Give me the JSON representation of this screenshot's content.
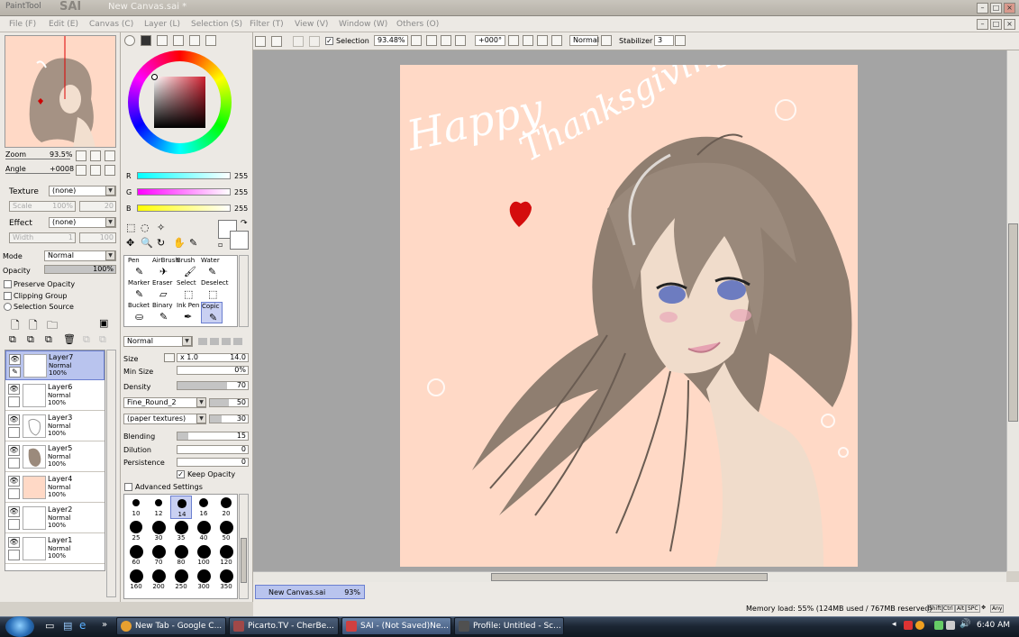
{
  "window": {
    "app_logo": "PaintTool",
    "app_name": "SAI",
    "title": "New Canvas.sai *"
  },
  "menu": [
    "File (F)",
    "Edit (E)",
    "Canvas (C)",
    "Layer (L)",
    "Selection (S)",
    "Filter (T)",
    "View (V)",
    "Window (W)",
    "Others (O)"
  ],
  "navigator": {
    "zoom_label": "Zoom",
    "zoom_value": "93.5%",
    "angle_label": "Angle",
    "angle_value": "+0008"
  },
  "texture": {
    "label": "Texture",
    "value": "(none)",
    "scale_label": "Scale",
    "scale_value": "100%",
    "scale_num": "20"
  },
  "effect": {
    "label": "Effect",
    "value": "(none)",
    "width_label": "Width",
    "width_value": "1",
    "width_num": "100"
  },
  "layer_props": {
    "mode_label": "Mode",
    "mode_value": "Normal",
    "opacity_label": "Opacity",
    "opacity_value": "100%",
    "opacity": 1.0,
    "preserve_opacity": "Preserve Opacity",
    "clipping_group": "Clipping Group",
    "selection_source": "Selection Source"
  },
  "layers": [
    {
      "name": "Layer7",
      "mode": "Normal",
      "opacity": "100%",
      "selected": true
    },
    {
      "name": "Layer6",
      "mode": "Normal",
      "opacity": "100%",
      "selected": false
    },
    {
      "name": "Layer3",
      "mode": "Normal",
      "opacity": "100%",
      "selected": false
    },
    {
      "name": "Layer5",
      "mode": "Normal",
      "opacity": "100%",
      "selected": false
    },
    {
      "name": "Layer4",
      "mode": "Normal",
      "opacity": "100%",
      "selected": false
    },
    {
      "name": "Layer2",
      "mode": "Normal",
      "opacity": "100%",
      "selected": false
    },
    {
      "name": "Layer1",
      "mode": "Normal",
      "opacity": "100%",
      "selected": false
    }
  ],
  "color": {
    "r_label": "R",
    "g_label": "G",
    "b_label": "B",
    "r": "255",
    "g": "255",
    "b": "255",
    "swatch": "#ffffff"
  },
  "tools": [
    {
      "name": "Pen",
      "icon": "pen-icon",
      "glyph": "✎"
    },
    {
      "name": "AirBrush",
      "icon": "airbrush-icon",
      "glyph": "✈"
    },
    {
      "name": "Brush",
      "icon": "brush-icon",
      "glyph": "🖌"
    },
    {
      "name": "Water",
      "icon": "water-icon",
      "glyph": "✎"
    },
    {
      "name": "Marker",
      "icon": "marker-icon",
      "glyph": "✎"
    },
    {
      "name": "Eraser",
      "icon": "eraser-icon",
      "glyph": "▱"
    },
    {
      "name": "Select",
      "icon": "select-icon",
      "glyph": "⬚"
    },
    {
      "name": "Deselect",
      "icon": "deselect-icon",
      "glyph": "⬚"
    },
    {
      "name": "Bucket",
      "icon": "bucket-icon",
      "glyph": "⛀"
    },
    {
      "name": "Binary",
      "icon": "binary-icon",
      "glyph": "✎"
    },
    {
      "name": "Ink Pen",
      "icon": "ink-pen-icon",
      "glyph": "✒"
    },
    {
      "name": "Copic",
      "icon": "copic-icon",
      "glyph": "✎"
    }
  ],
  "brush": {
    "blend_mode": "Normal",
    "size_label": "Size",
    "size_mult": "x 1.0",
    "size_value": "14.0",
    "min_size_label": "Min Size",
    "min_size_value": "0%",
    "density_label": "Density",
    "density_value": "70",
    "shape": "Fine_Round_2",
    "shape_value": "50",
    "texture": "(paper textures)",
    "texture_value": "30",
    "blending_label": "Blending",
    "blending_value": "15",
    "dilution_label": "Dilution",
    "dilution_value": "0",
    "persistence_label": "Persistence",
    "persistence_value": "0",
    "keep_opacity": "Keep Opacity",
    "advanced": "Advanced Settings",
    "presets": [
      "10",
      "12",
      "14",
      "16",
      "20",
      "25",
      "30",
      "35",
      "40",
      "50",
      "60",
      "70",
      "80",
      "100",
      "120",
      "160",
      "200",
      "250",
      "300",
      "350"
    ]
  },
  "canvas_toolbar": {
    "selection_label": "Selection",
    "zoom": "93.48%",
    "angle": "+000°",
    "blend": "Normal",
    "stabilizer_label": "Stabilizer",
    "stabilizer_value": "3"
  },
  "artwork": {
    "greeting_line1": "Happy",
    "greeting_line2": "Thanksgiving.",
    "background": "#ffd9c6"
  },
  "doc_tab": {
    "name": "New Canvas.sai",
    "zoom": "93%"
  },
  "status": {
    "memory": "Memory load: 55% (124MB used / 767MB reserved)",
    "keys": [
      "Shift",
      "Ctrl",
      "Alt",
      "SPC",
      "Any"
    ]
  },
  "taskbar": {
    "items": [
      {
        "label": "New Tab - Google C...",
        "color": "#e8a030"
      },
      {
        "label": "Picarto.TV - CherBe...",
        "color": "#a04848"
      },
      {
        "label": "SAI - (Not Saved)Ne...",
        "color": "#d04040"
      },
      {
        "label": "Profile: Untitled - Sc...",
        "color": "#505050"
      }
    ],
    "clock": "6:40 AM"
  }
}
